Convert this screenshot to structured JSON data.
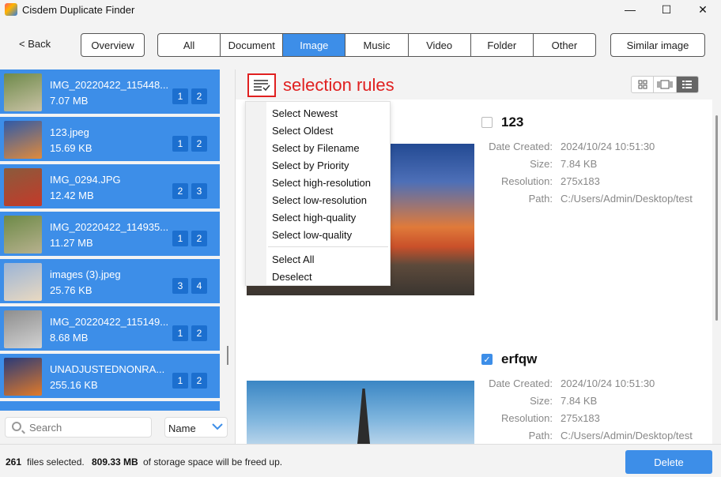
{
  "window": {
    "title": "Cisdem Duplicate Finder",
    "min_glyph": "—",
    "max_glyph": "☐",
    "close_glyph": "✕"
  },
  "toolbar": {
    "back_label": "< Back",
    "overview_label": "Overview",
    "tabs": [
      "All",
      "Document",
      "Image",
      "Music",
      "Video",
      "Folder",
      "Other"
    ],
    "active_tab": "Image",
    "similar_label": "Similar image"
  },
  "groups": [
    {
      "name": "IMG_20220422_115448...",
      "size": "7.07 MB",
      "badges": [
        "1",
        "2"
      ],
      "thumb_colors": [
        "#6e8a4a",
        "#c9c2a5"
      ]
    },
    {
      "name": "123.jpeg",
      "size": "15.69 KB",
      "badges": [
        "1",
        "2"
      ],
      "thumb_colors": [
        "#2f5aa8",
        "#e08a3c"
      ]
    },
    {
      "name": "IMG_0294.JPG",
      "size": "12.42 MB",
      "badges": [
        "2",
        "3"
      ],
      "thumb_colors": [
        "#8a5b3c",
        "#c43a2a"
      ]
    },
    {
      "name": "IMG_20220422_114935...",
      "size": "11.27 MB",
      "badges": [
        "1",
        "2"
      ],
      "thumb_colors": [
        "#6d8a47",
        "#b7b18e"
      ]
    },
    {
      "name": "images (3).jpeg",
      "size": "25.76 KB",
      "badges": [
        "3",
        "4"
      ],
      "thumb_colors": [
        "#9bb4d6",
        "#e9d9c1"
      ]
    },
    {
      "name": "IMG_20220422_115149...",
      "size": "8.68 MB",
      "badges": [
        "1",
        "2"
      ],
      "thumb_colors": [
        "#8e8e8e",
        "#d2d2d2"
      ]
    },
    {
      "name": "UNADJUSTEDNONRA...",
      "size": "255.16 KB",
      "badges": [
        "1",
        "2"
      ],
      "thumb_colors": [
        "#2a3a78",
        "#e07a2a"
      ]
    }
  ],
  "search": {
    "placeholder": "Search",
    "value": ""
  },
  "sort": {
    "selected": "Name"
  },
  "selection_rules_label": "selection rules",
  "rules_menu": {
    "items": [
      "Select Newest",
      "Select Oldest",
      "Select by Filename",
      "Select by Priority",
      "Select high-resolution",
      "Select low-resolution",
      "Select high-quality",
      "Select low-quality"
    ],
    "extra": [
      "Select All",
      "Deselect"
    ]
  },
  "files": [
    {
      "title": "123",
      "checked": false,
      "labels": [
        "Date Created:",
        "Size:",
        "Resolution:",
        "Path:"
      ],
      "values": [
        "2024/10/24 10:51:30",
        "7.84 KB",
        "275x183",
        "C:/Users/Admin/Desktop/test"
      ]
    },
    {
      "title": "erfqw",
      "checked": true,
      "labels": [
        "Date Created:",
        "Size:",
        "Resolution:",
        "Path:"
      ],
      "values": [
        "2024/10/24 10:51:30",
        "7.84 KB",
        "275x183",
        "C:/Users/Admin/Desktop/test"
      ]
    }
  ],
  "status": {
    "count": "261",
    "text1": "files selected.",
    "size": "809.33 MB",
    "text2": "of storage space will be freed up."
  },
  "delete_label": "Delete",
  "colors": {
    "accent": "#3d8ee8",
    "badge": "#1c6fcf",
    "highlight_red": "#e02020"
  }
}
